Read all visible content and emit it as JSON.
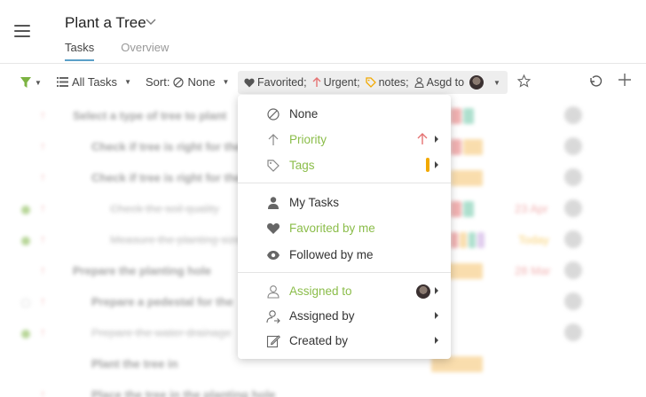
{
  "header": {
    "title": "Plant a Tree",
    "tabs": [
      {
        "label": "Tasks",
        "active": true
      },
      {
        "label": "Overview",
        "active": false
      }
    ]
  },
  "toolbar": {
    "view_label": "All Tasks",
    "sort_label": "Sort:",
    "sort_value": "None",
    "chip": {
      "favorited": "Favorited;",
      "urgent": "Urgent;",
      "notes": "notes;",
      "assigned": "Asgd to"
    }
  },
  "menu": {
    "items": [
      {
        "label": "None",
        "icon": "none-icon"
      },
      {
        "label": "Priority",
        "icon": "arrow-up-icon"
      },
      {
        "label": "Tags",
        "icon": "tag-icon"
      },
      {
        "label": "My Tasks",
        "icon": "person-icon"
      },
      {
        "label": "Favorited by me",
        "icon": "heart-icon"
      },
      {
        "label": "Followed by me",
        "icon": "eye-icon"
      },
      {
        "label": "Assigned to",
        "icon": "person-outline-icon"
      },
      {
        "label": "Assigned by",
        "icon": "person-arrow-icon"
      },
      {
        "label": "Created by",
        "icon": "edit-icon"
      }
    ]
  },
  "tasks": [
    {
      "title": "Select a type of tree to plant",
      "date": ""
    },
    {
      "title": "Check if tree is right for the",
      "date": ""
    },
    {
      "title": "Check if tree is right for the",
      "date": ""
    },
    {
      "title": "Check the soil quality",
      "date": "23 Apr"
    },
    {
      "title": "Measure the planting size",
      "date": "Today"
    },
    {
      "title": "Prepare the planting hole",
      "date": "28 Mar"
    },
    {
      "title": "Prepare a pedestal for the",
      "date": ""
    },
    {
      "title": "Prepare the water drainage",
      "date": ""
    },
    {
      "title": "Plant the tree in",
      "date": ""
    },
    {
      "title": "Place the tree in the planting hole",
      "date": ""
    }
  ],
  "colors": {
    "accent_green": "#8bbd4a",
    "urgent_red": "#e57373",
    "tag_orange": "#f2a900",
    "tab_underline": "#5aa0c8"
  }
}
